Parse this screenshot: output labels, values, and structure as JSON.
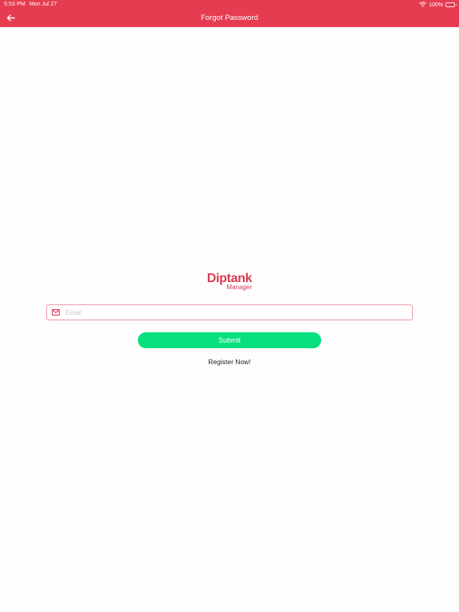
{
  "status_bar": {
    "time": "5:53 PM",
    "date": "Mon Jul 27",
    "battery": "100%"
  },
  "header": {
    "title": "Forgot Password",
    "back_icon": "arrow-left-icon"
  },
  "logo": {
    "main": "Diptank",
    "sub": "Manager"
  },
  "form": {
    "email_icon": "envelope-icon",
    "email_placeholder": "Email",
    "email_value": "",
    "submit_label": "Submit",
    "register_label": "Register Now!"
  },
  "colors": {
    "brand_red": "#e53c51",
    "submit_green": "#07e07d"
  }
}
